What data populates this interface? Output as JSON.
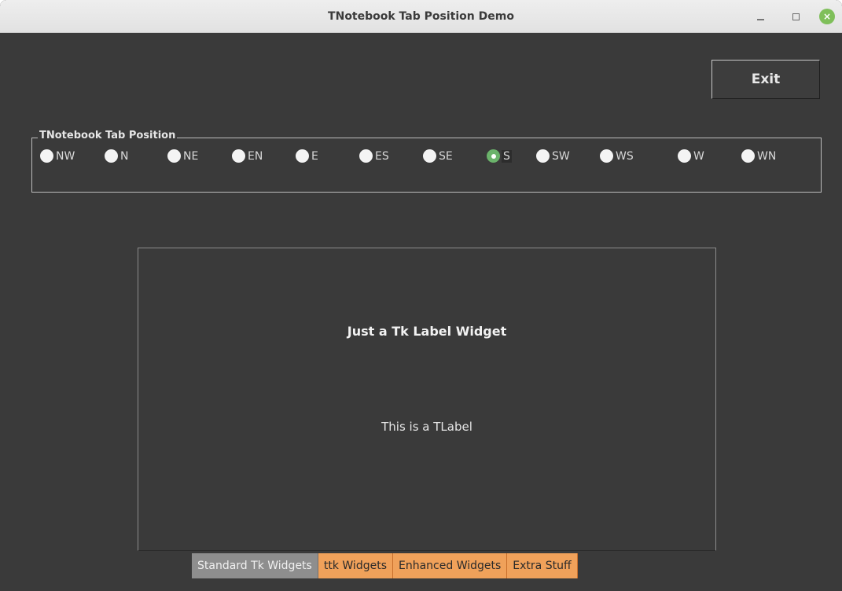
{
  "window": {
    "title": "TNotebook Tab Position Demo",
    "controls": {
      "minimize": "–",
      "maximize": "□",
      "close": "×"
    }
  },
  "exit_button": {
    "label": "Exit"
  },
  "tab_position": {
    "legend": "TNotebook Tab Position",
    "options": [
      "NW",
      "N",
      "NE",
      "EN",
      "E",
      "ES",
      "SE",
      "S",
      "SW",
      "WS",
      "W",
      "WN"
    ],
    "selected": "S"
  },
  "panel": {
    "tk_label": "Just a Tk Label Widget",
    "ttk_label": "This is a TLabel"
  },
  "tabs": [
    {
      "label": "Standard Tk Widgets",
      "active": true
    },
    {
      "label": "ttk Widgets",
      "active": false
    },
    {
      "label": "Enhanced Widgets",
      "active": false
    },
    {
      "label": "Extra Stuff",
      "active": false
    }
  ],
  "colors": {
    "background": "#3a3a3a",
    "selected_radio": "#6bb36b",
    "inactive_tab": "#f0a15a",
    "active_tab": "#8e8e8e"
  }
}
